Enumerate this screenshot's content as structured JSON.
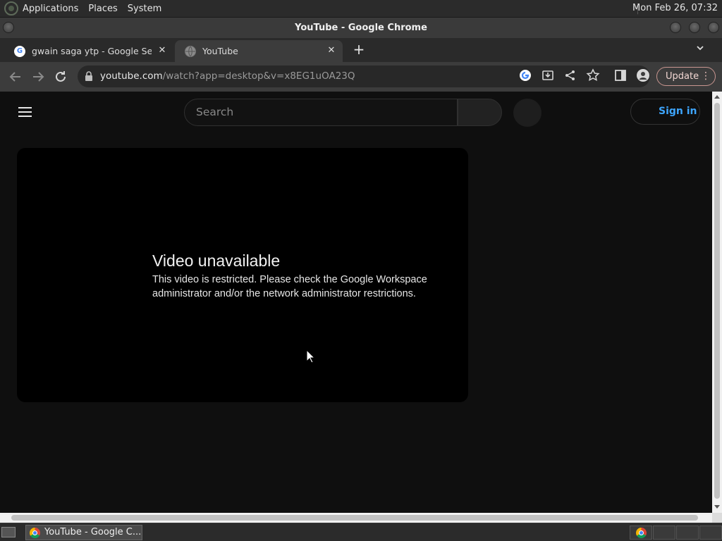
{
  "system_panel": {
    "menus": [
      "Applications",
      "Places",
      "System"
    ],
    "clock": "Mon Feb 26, 07:32"
  },
  "window": {
    "title": "YouTube - Google Chrome"
  },
  "tabs": [
    {
      "title": "gwain saga ytp - Google Search",
      "favicon": "google-icon",
      "active": false
    },
    {
      "title": "YouTube",
      "favicon": "globe-icon",
      "active": true
    }
  ],
  "toolbar": {
    "url_host": "youtube.com",
    "url_path": "/watch?app=desktop&v=x8EG1uOA23Q",
    "update_label": "Update"
  },
  "youtube": {
    "search_placeholder": "Search",
    "signin_label": "Sign in"
  },
  "player": {
    "error_title": "Video unavailable",
    "error_message": "This video is restricted. Please check the Google Workspace administrator and/or the network administrator restrictions."
  },
  "taskbar": {
    "task_label": "YouTube - Google C..."
  },
  "colors": {
    "page_bg": "#0f0f0f",
    "signin_blue": "#3ea6ff",
    "update_border": "#c99690"
  }
}
